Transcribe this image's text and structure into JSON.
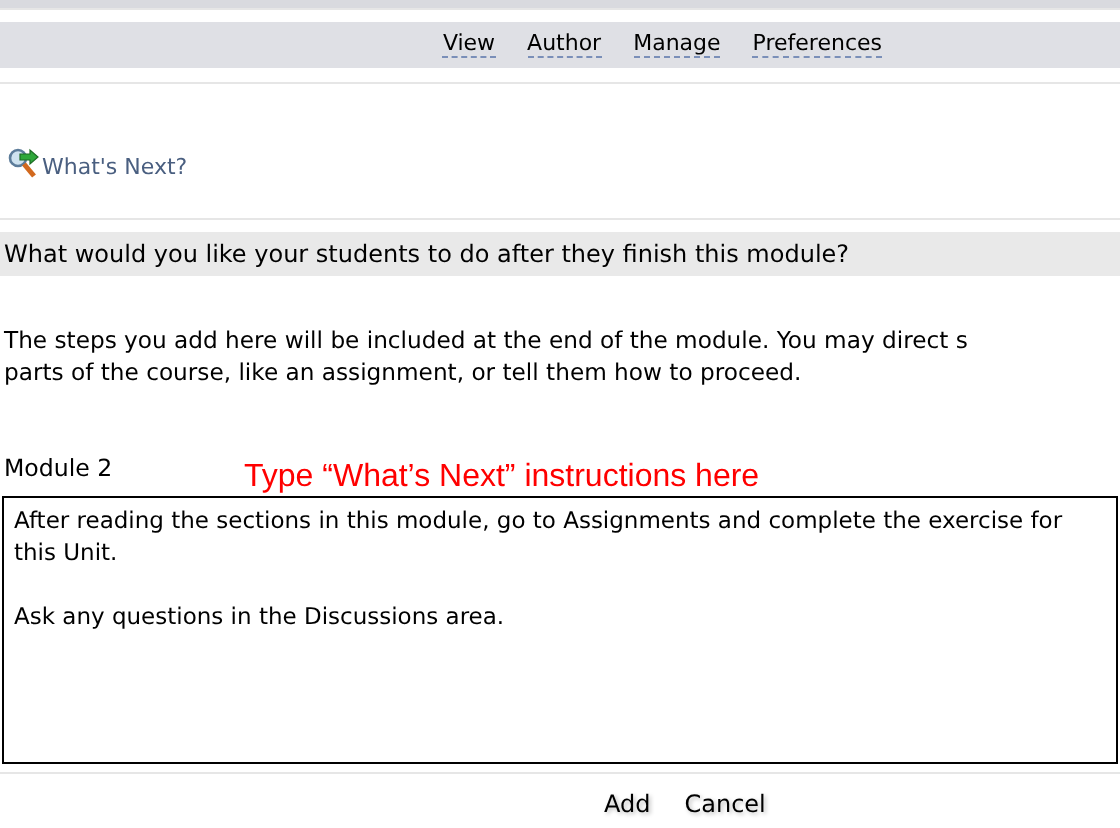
{
  "nav": {
    "links": [
      {
        "label": "View"
      },
      {
        "label": "Author"
      },
      {
        "label": "Manage"
      },
      {
        "label": "Preferences"
      }
    ]
  },
  "page_title": "What's Next?",
  "question": "What would you like your students to do after they finish this module?",
  "description": "The steps you add here will be included at the end of the module. You may direct s\nparts of the course, like an assignment, or tell them how to proceed.",
  "module_label": "Module 2",
  "annotation": "Type “What’s Next” instructions here",
  "instructions_field": {
    "value": "After reading the sections in this module, go to Assignments and complete the exercise for this Unit.\n\nAsk any questions in the Discussions area."
  },
  "buttons": [
    {
      "label": "Add"
    },
    {
      "label": "Cancel"
    }
  ]
}
